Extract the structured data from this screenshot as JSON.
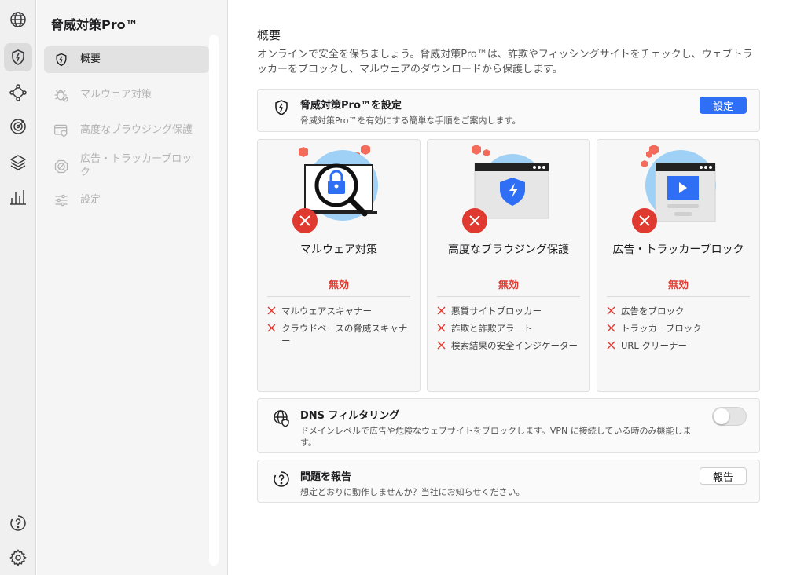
{
  "app": {
    "title": "脅威対策Pro™"
  },
  "rail": {
    "items": [
      {
        "icon": "globe-icon"
      },
      {
        "icon": "shield-bolt-icon",
        "active": true
      },
      {
        "icon": "mesh-network-icon"
      },
      {
        "icon": "target-icon"
      },
      {
        "icon": "layers-icon"
      },
      {
        "icon": "bar-chart-icon"
      }
    ],
    "bottom": [
      {
        "icon": "help-icon"
      },
      {
        "icon": "gear-icon"
      }
    ]
  },
  "sidebar": {
    "items": [
      {
        "label": "概要",
        "icon": "shield-bolt-icon",
        "active": true
      },
      {
        "label": "マルウェア対策",
        "icon": "bug-icon"
      },
      {
        "label": "高度なブラウジング保護",
        "icon": "browser-shield-icon"
      },
      {
        "label": "広告・トラッカーブロック",
        "icon": "block-icon"
      },
      {
        "label": "設定",
        "icon": "sliders-icon"
      }
    ]
  },
  "main": {
    "title": "概要",
    "intro": "オンラインで安全を保ちましょう。脅威対策Pro™は、詐欺やフィッシングサイトをチェックし、ウェブトラッカーをブロックし、マルウェアのダウンロードから保護します。",
    "setup": {
      "title": "脅威対策Pro™を設定",
      "desc": "脅威対策Pro™を有効にする簡単な手順をご案内します。",
      "button": "設定"
    },
    "cards": [
      {
        "title": "マルウェア対策",
        "status": "無効",
        "items": [
          "マルウェアスキャナー",
          "クラウドベースの脅威スキャナー"
        ]
      },
      {
        "title": "高度なブラウジング保護",
        "status": "無効",
        "items": [
          "悪質サイトブロッカー",
          "詐欺と詐欺アラート",
          "検索結果の安全インジケーター"
        ]
      },
      {
        "title": "広告・トラッカーブロック",
        "status": "無効",
        "items": [
          "広告をブロック",
          "トラッカーブロック",
          "URL クリーナー"
        ]
      }
    ],
    "dns": {
      "title": "DNS フィルタリング",
      "desc": "ドメインレベルで広告や危険なウェブサイトをブロックします。VPN に接続している時のみ機能します。",
      "enabled": false
    },
    "report": {
      "title": "問題を報告",
      "desc": "想定どおりに動作しませんか？当社にお知らせください。",
      "button": "報告"
    }
  },
  "colors": {
    "accent": "#2f6ff5",
    "danger": "#e0392f",
    "illustration_blue": "#9fd0f5",
    "shield_blue": "#2f6ff5",
    "hexagon_red": "#f26b5b"
  }
}
